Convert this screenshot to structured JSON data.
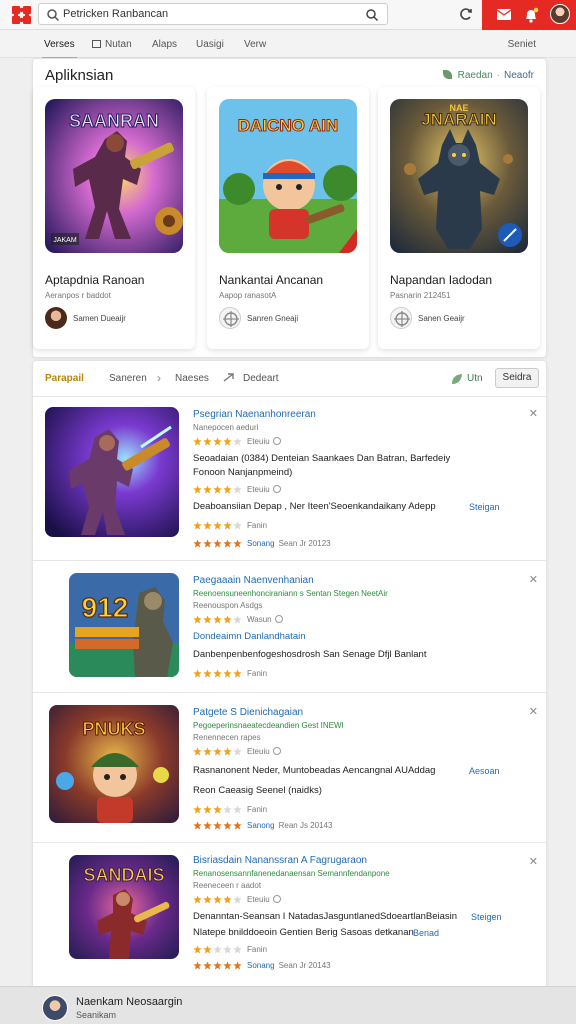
{
  "colors": {
    "accent": "#e52a24",
    "tab_underline": "#e8a321",
    "link_blue": "#1e6bb8",
    "star": "#f0a21a",
    "star_hot": "#e2761e"
  },
  "header": {
    "search_value": "Petricken Ranbancan",
    "logo_icon": "puzzle-logo-icon",
    "refresh_icon": "refresh-icon",
    "mail_icon": "mail-icon",
    "bell_icon": "bell-icon"
  },
  "tabs": {
    "items": [
      {
        "label": "Verses"
      },
      {
        "label": "Nutan"
      },
      {
        "label": "Alaps"
      },
      {
        "label": "Uasigi"
      },
      {
        "label": "Verw"
      }
    ],
    "right_label": "Seniet"
  },
  "featured": {
    "title": "Apliknsian",
    "action_label": "Raedan",
    "action_sep": "·",
    "action_label2": "Neaofr",
    "cards": [
      {
        "art_text": "SAANRAN",
        "art_tag": "JAKAM",
        "name": "Aptapdnia Ranoan",
        "meta": "Aeranpos r baddot",
        "developer": "Samen Dueaijr"
      },
      {
        "art_text": "DAICNO AIN",
        "art_tag": "",
        "name": "Nankantai Ancanan",
        "meta": "Aapop ranasotA",
        "developer": "Sanren Gneaji"
      },
      {
        "art_text": "JNARAIN",
        "art_tag": "NAE",
        "name": "Napandan Iadodan",
        "meta": "Pasnarin 212451",
        "developer": "Sanen Geaijr"
      }
    ]
  },
  "list": {
    "breadcrumbs": [
      "Parapail",
      "Saneren",
      "Naeses",
      "Dedeart"
    ],
    "utn_label": "Utn",
    "button_label": "Seidra",
    "rows": [
      {
        "title": "Psegrian Naenanhonreeran",
        "sub": "Nanepocen aeduri",
        "stars1": "Eteuiu",
        "line1": "Seoadaian  (0384) Denteian Saankaes Dan Batran, Barfedeiy",
        "line2": "Fonoon        Nanjanpmeind)",
        "stars2": "Eteuiu",
        "line3": "Deaboansiian Depap , Ner Iteen'Seoenkandaikany Adepp",
        "link": "Steigan",
        "stars3": "Fanin",
        "stars4": "Sonang",
        "date": "Sean Jr 20123"
      },
      {
        "title": "Paegaaain  Naenvenhanian",
        "sub": "Reenoensuneenhonciraniann s Sentan Stegen NeetAir",
        "sub2": "Reenouspon Asdgs",
        "stars1": "Wasun",
        "line1": "Dondeaimn  Danlandhatain",
        "line2": "Danbenpenbenfogeshosdrosh San Senage Dfjl Banlant",
        "stars3": "Fanin"
      },
      {
        "title": "Patgete S Dienichagaian",
        "sub": "Pegoeperinsnaeatecdeandien Gest INEWI",
        "sub2": "Renennecen rapes",
        "stars1": "Eteuiu",
        "line1": "Rasnanonent Neder, Muntobeadas Aencangnal AUAddag",
        "link": "Aesoan",
        "line2": "Reon Caeasig Seenel (naidks)",
        "stars3": "Fanin",
        "stars4": "Sanong",
        "date": "Rean Js 20143"
      },
      {
        "title": "Bisriasdain Nananssran  A  Fagrugaraon",
        "sub": "Renanosensannfanenedanaensan Semannfendanpone",
        "sub2": "Reeneceen r aadot",
        "stars1": "Eteuiu",
        "line1": "Denanntan-Seansan I NatadasJasguntlanedSdoeartlanBeiasin",
        "link": "Steigen",
        "line2": "Nlatepe bnilddoeoin Gentien Berig  Sasoas detkanan",
        "link2": "Benad",
        "stars3": "Fanin",
        "stars4": "Sonang",
        "date": "Sean Jr 20143"
      }
    ]
  },
  "profile": {
    "name": "Naenkam Neosaargin",
    "sub": "Seanikam"
  }
}
